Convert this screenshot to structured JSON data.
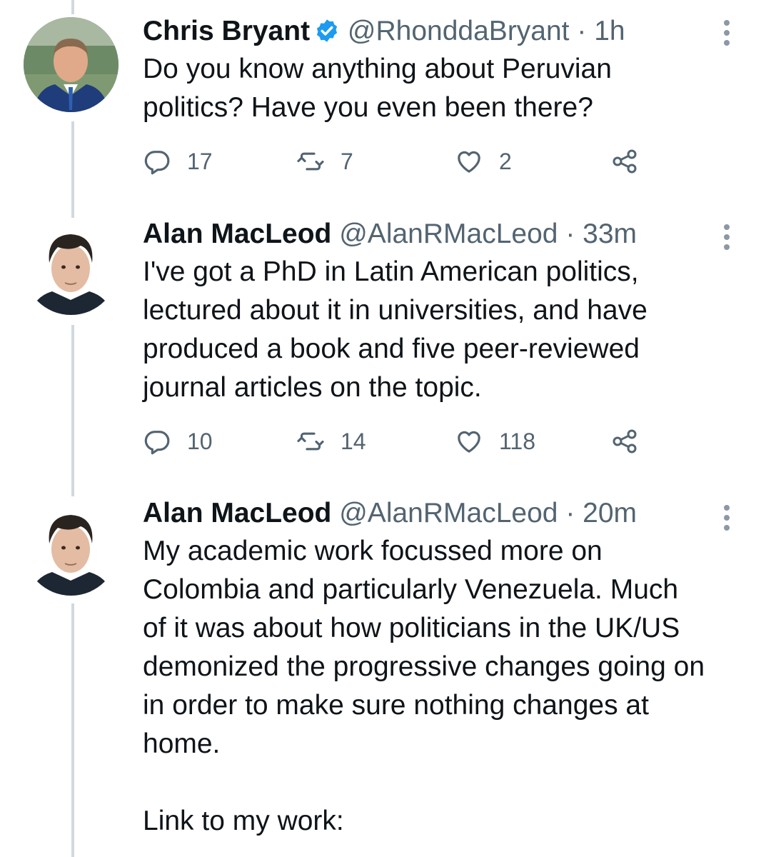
{
  "tweets": [
    {
      "name": "Chris Bryant",
      "verified": true,
      "handle": "@RhonddaBryant",
      "separator": "·",
      "time": "1h",
      "text": "Do you know anything about Peruvian\npolitics? Have you even been there?",
      "replies": "17",
      "retweets": "7",
      "likes": "2"
    },
    {
      "name": "Alan MacLeod",
      "verified": false,
      "handle": "@AlanRMacLeod",
      "separator": "·",
      "time": "33m",
      "text": "I've got a PhD in Latin American politics,\nlectured about it in universities, and have\nproduced a book and five peer-reviewed\njournal articles on the topic.",
      "replies": "10",
      "retweets": "14",
      "likes": "118"
    },
    {
      "name": "Alan MacLeod",
      "verified": false,
      "handle": "@AlanRMacLeod",
      "separator": "·",
      "time": "20m",
      "text": "My academic work focussed more on\nColombia and particularly Venezuela. Much\nof it was about how politicians in the UK/US\ndemonized the progressive changes going on\nin order to make sure nothing changes at\nhome.\n\nLink to my work:"
    }
  ],
  "colors": {
    "text": "#0f1419",
    "secondary": "#536471",
    "verified": "#1d9bf0",
    "thread": "#cfd9de"
  },
  "icons": [
    "verified-badge-icon",
    "more-icon",
    "reply-icon",
    "retweet-icon",
    "like-icon",
    "share-icon"
  ]
}
